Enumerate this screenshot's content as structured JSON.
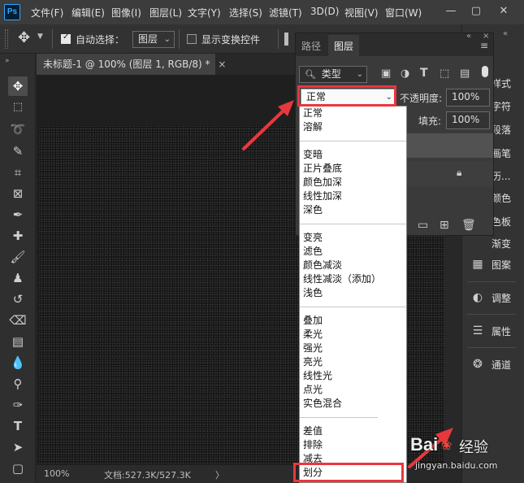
{
  "app": {
    "logo": "Ps"
  },
  "menubar": {
    "items": [
      "文件(F)",
      "编辑(E)",
      "图像(I)",
      "图层(L)",
      "文字(Y)",
      "选择(S)",
      "滤镜(T)",
      "3D(D)",
      "视图(V)",
      "窗口(W)"
    ],
    "window_controls": [
      "—",
      "▢",
      "✕"
    ]
  },
  "options": {
    "auto_select_label": "自动选择：",
    "auto_select_checked": true,
    "target_value": "图层",
    "show_transform_label": "显示变换控件",
    "show_transform_checked": false
  },
  "document": {
    "tab_title": "未标题-1 @ 100% (图层 1, RGB/8) *",
    "tab_close": "×",
    "zoom": "100%",
    "doc_info": "文档:527.3K/527.3K",
    "status_arrow": "〉"
  },
  "panel": {
    "tabs": [
      "路径",
      "图层"
    ],
    "active_tab": "图层",
    "filter_label": "类型",
    "blend_mode": "正常",
    "opacity_label": "不透明度:",
    "opacity_value": "100%",
    "fill_label": "填充:",
    "fill_value": "100%",
    "menu_icon": "≡"
  },
  "blend_list": {
    "groups": [
      [
        "正常",
        "溶解"
      ],
      [
        "变暗",
        "正片叠底",
        "颜色加深",
        "线性加深",
        "深色"
      ],
      [
        "变亮",
        "滤色",
        "颜色减淡",
        "线性减淡（添加）",
        "浅色"
      ],
      [
        "叠加",
        "柔光",
        "强光",
        "亮光",
        "线性光",
        "点光",
        "实色混合"
      ],
      [
        "差值",
        "排除",
        "减去",
        "划分"
      ]
    ],
    "highlighted": "划分"
  },
  "dock": {
    "partial_items": [
      "样式",
      "字符",
      "段落",
      "画笔",
      "历...",
      "颜色",
      "色板",
      "渐变"
    ],
    "items": [
      {
        "label": "图案",
        "icon": "pattern-icon"
      },
      {
        "label": "调整",
        "icon": "adjustments-icon"
      },
      {
        "label": "属性",
        "icon": "properties-icon"
      },
      {
        "label": "通道",
        "icon": "channels-icon"
      }
    ]
  },
  "watermark": {
    "brand": "Bai",
    "brand_cn": "经验",
    "url": "jingyan.baidu.com"
  }
}
